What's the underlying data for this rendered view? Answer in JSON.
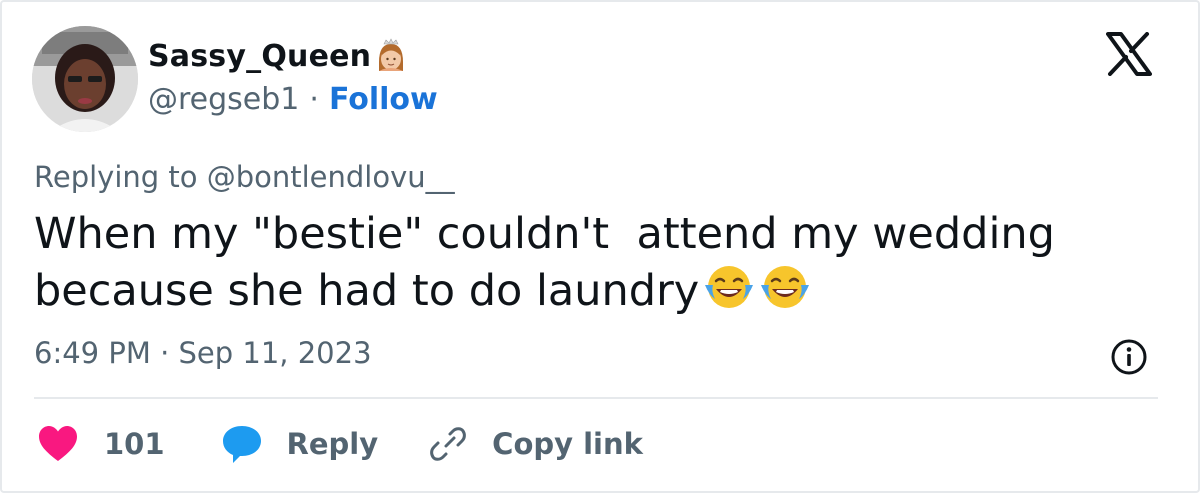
{
  "author": {
    "display_name": "Sassy_Queen",
    "name_emoji": "princess-emoji",
    "handle": "@regseb1",
    "separator": "·",
    "follow_label": "Follow"
  },
  "platform_logo": "x-logo",
  "reply": {
    "replying_to": "Replying to @bontlendlovu__"
  },
  "tweet": {
    "text": "When my \"bestie\" couldn't  attend my wedding because she had to do laundry",
    "emojis": [
      "face-with-tears-of-joy",
      "face-with-tears-of-joy"
    ]
  },
  "timestamp": "6:49 PM · Sep 11, 2023",
  "actions": {
    "like_count": "101",
    "reply_label": "Reply",
    "copy_link_label": "Copy link"
  },
  "colors": {
    "accent_blue": "#1a73d8",
    "heart_pink": "#f91880",
    "reply_blue": "#1d9bf0",
    "secondary_text": "#536471"
  }
}
